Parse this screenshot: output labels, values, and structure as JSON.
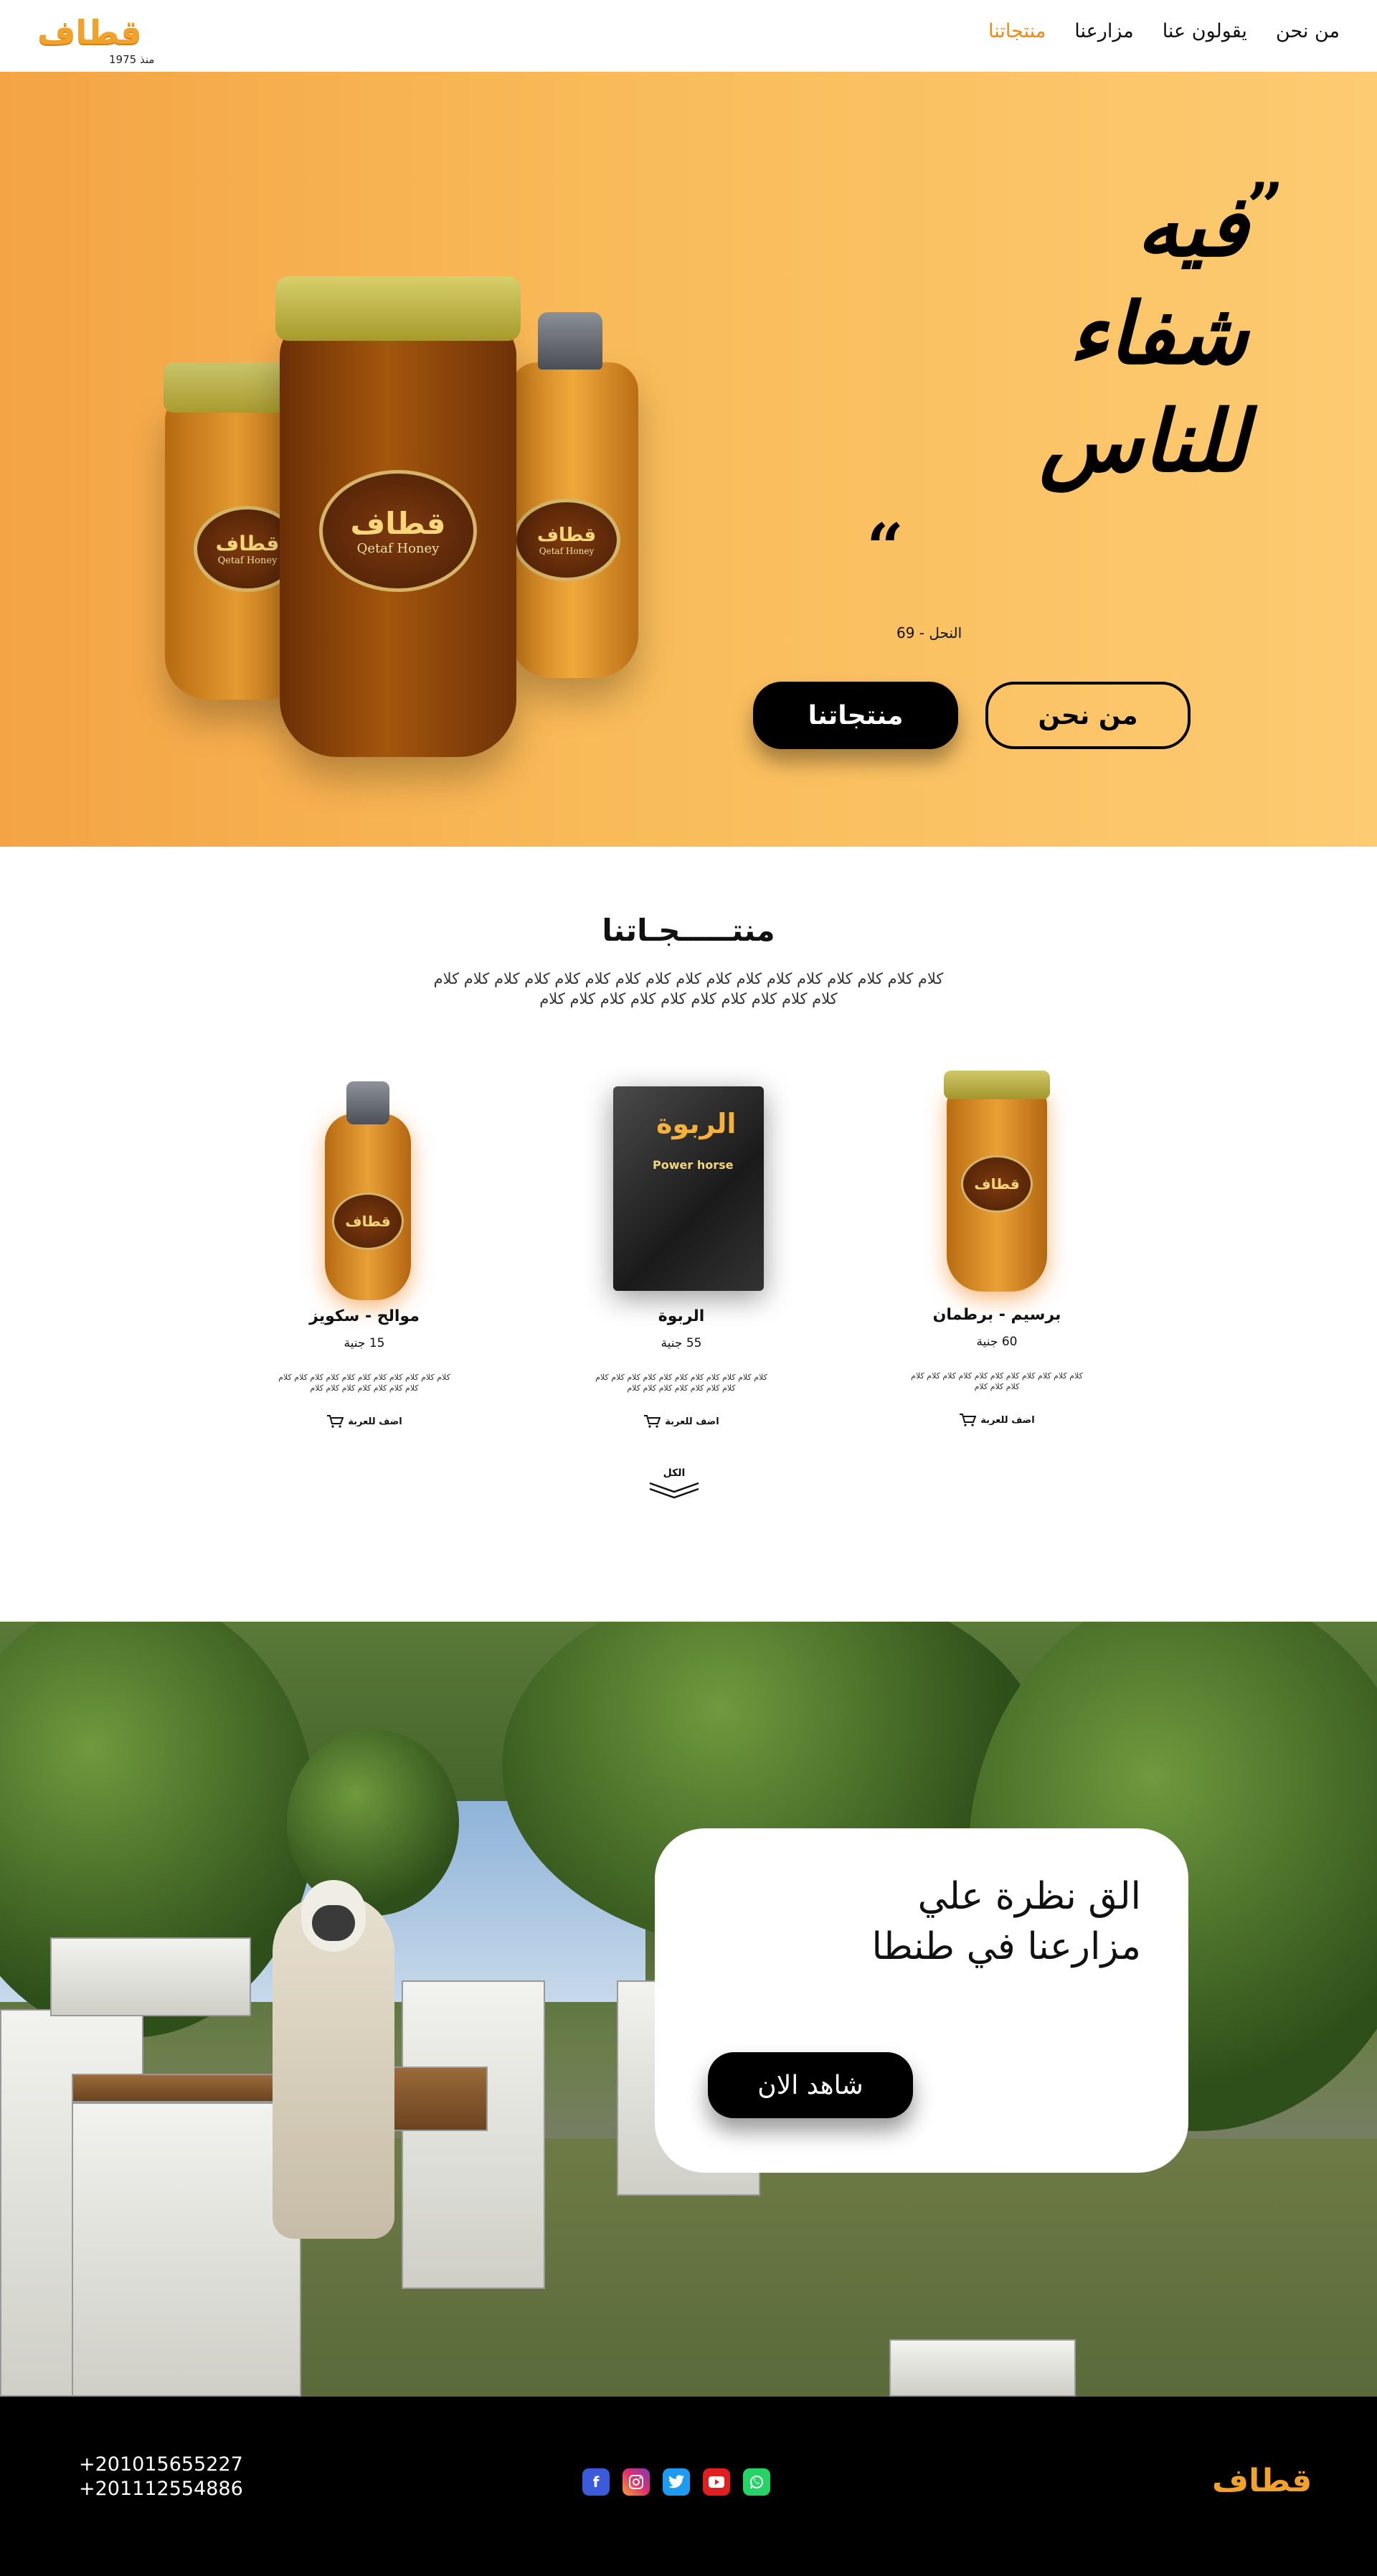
{
  "brand": {
    "logo_text": "قطاف",
    "since": "منذ 1975",
    "colors": {
      "accent": "#f08a12",
      "hero_bg": "#fbbf5f",
      "dark": "#000000"
    }
  },
  "nav": {
    "items": [
      "منتجاتنا",
      "مزارعنا",
      "يقولون عنا",
      "من نحن"
    ],
    "active_index": 0
  },
  "hero": {
    "quote_lines": [
      "فيه",
      "شفاء",
      "للناس"
    ],
    "open_quote": "”",
    "close_quote": "“",
    "citation": "النحل - 69",
    "about_button": "من نحن",
    "products_button": "منتجاتنا",
    "jar_label": "قطاف",
    "jar_label_en": "Qetaf Honey"
  },
  "products_section": {
    "title": "منتـــــجـاتنا",
    "description": "كلام كلام كلام كلام كلام كلام كلام كلام كلام كلام كلام كلام كلام كلام كلام كلام كلام كلام كلام كلام كلام كلام كلام كلام كلام كلام كلام",
    "items": [
      {
        "name": "برسيم - برطمان",
        "price": "60 جنية",
        "description": "كلام كلام كلام كلام كلام كلام كلام كلام كلام كلام كلام كلام كلام كلام",
        "cart_label": "اضف للعربة",
        "image_icon": "honey-jar"
      },
      {
        "name": "الربوة",
        "price": "55 جنية",
        "description": "كلام كلام كلام كلام كلام كلام كلام كلام كلام كلام كلام كلام كلام كلام كلام كلام كلام كلام",
        "cart_label": "اضف للعربة",
        "image_icon": "product-box"
      },
      {
        "name": "موالح - سكويز",
        "price": "15 جنية",
        "description": "كلام كلام كلام كلام كلام كلام كلام كلام كلام كلام كلام كلام كلام كلام كلام كلام كلام كلام",
        "cart_label": "اضف للعربة",
        "image_icon": "squeeze-bottle"
      }
    ],
    "all_label": "الكل"
  },
  "farm": {
    "title_line1": "الق نظرة علي",
    "title_line2": "مزارعنا في طنطا",
    "button": "شاهد الان"
  },
  "footer": {
    "phones": [
      "+201015655227",
      "+201112554886"
    ],
    "socials": [
      "facebook-icon",
      "instagram-icon",
      "twitter-icon",
      "youtube-icon",
      "whatsapp-icon"
    ],
    "logo_text": "قطاف"
  }
}
